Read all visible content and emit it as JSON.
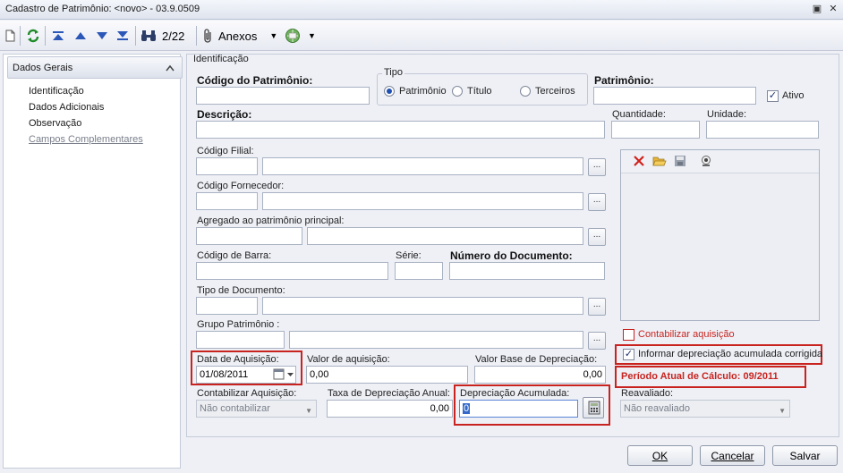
{
  "window": {
    "title": "Cadastro de Patrimônio: <novo> - 03.9.0509",
    "pin_glyph": "▣",
    "close_glyph": "✕"
  },
  "toolbar": {
    "record_counter": "2/22",
    "anexos_label": "Anexos"
  },
  "sidebar": {
    "header": "Dados Gerais",
    "items": [
      {
        "label": "Identificação"
      },
      {
        "label": "Dados Adicionais"
      },
      {
        "label": "Observação"
      },
      {
        "label": "Campos Complementares"
      }
    ]
  },
  "form": {
    "section_title": "Identificação",
    "codigo_patrimonio_label": "Código do Patrimônio:",
    "tipo": {
      "label": "Tipo",
      "options": [
        "Patrimônio",
        "Título",
        "Terceiros"
      ],
      "selected": "Patrimônio"
    },
    "patrimonio_label": "Patrimônio:",
    "ativo_label": "Ativo",
    "ativo_checked": true,
    "descricao_label": "Descrição:",
    "quantidade_label": "Quantidade:",
    "unidade_label": "Unidade:",
    "codigo_filial_label": "Código Filial:",
    "codigo_fornecedor_label": "Código Fornecedor:",
    "agregado_label": "Agregado ao patrimônio principal:",
    "codigo_barra_label": "Código de Barra:",
    "serie_label": "Série:",
    "numero_documento_label": "Número do Documento:",
    "tipo_documento_label": "Tipo de Documento:",
    "grupo_patrimonio_label": "Grupo Patrimônio :",
    "ellipsis_glyph": "...",
    "data_aquisicao_label": "Data de Aquisição:",
    "data_aquisicao_value": "01/08/2011",
    "valor_aquisicao_label": "Valor de aquisição:",
    "valor_aquisicao_value": "0,00",
    "valor_base_depreciacao_label": "Valor Base de Depreciação:",
    "valor_base_depreciacao_value": "0,00",
    "contabilizar_aquisicao_select_label": "Contabilizar Aquisição:",
    "contabilizar_aquisicao_select_value": "Não contabilizar",
    "taxa_depreciacao_label": "Taxa de Depreciação Anual:",
    "taxa_depreciacao_value": "0,00",
    "depreciacao_acumulada_label": "Depreciação Acumulada:",
    "depreciacao_acumulada_value": "0",
    "reavaliado_label": "Reavaliado:",
    "reavaliado_value": "Não reavaliado",
    "contabilizar_aquisicao_check_label": "Contabilizar aquisição",
    "contabilizar_aquisicao_checked": false,
    "informar_depreciacao_label": "Informar depreciação acumulada corrigida",
    "informar_depreciacao_checked": true,
    "periodo_atual": "Período Atual de Cálculo: 09/2011"
  },
  "footer": {
    "ok_label": "OK",
    "cancel_label": "Cancelar",
    "save_label": "Salvar"
  },
  "colors": {
    "highlight_red": "#c8231f",
    "radio_selected": "#1f4fb0"
  }
}
